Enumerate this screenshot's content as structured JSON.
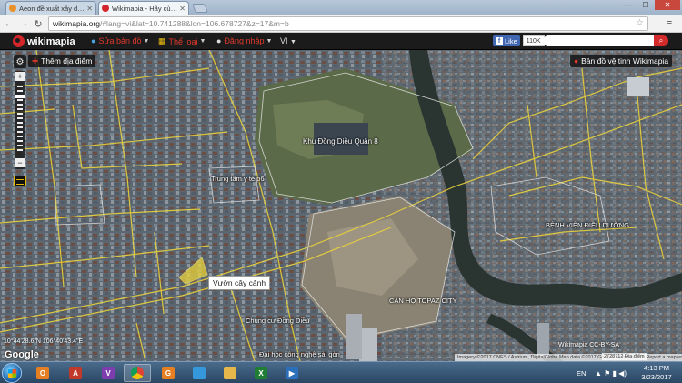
{
  "browser": {
    "tabs": [
      {
        "label": "Aeon đề xuất xây dựng tổ",
        "favicon_color": "#e8912a",
        "active": false
      },
      {
        "label": "Wikimapia - Hãy cùng nh",
        "favicon_color": "#d4262a",
        "active": true
      }
    ],
    "window_controls": {
      "minimize": "—",
      "maximize": "☐",
      "close": "✕"
    },
    "url_host": "wikimapia.org",
    "url_rest": "/#lang=vi&lat=10.741288&lon=106.678727&z=17&m=b"
  },
  "wikimapia": {
    "logo": "wikimapia",
    "menu": [
      {
        "label": "Sửa bản đồ",
        "icon": "globe-icon"
      },
      {
        "label": "Thể loại",
        "icon": "category-icon"
      },
      {
        "label": "Đăng nhập",
        "icon": "user-icon"
      }
    ],
    "language": "VI",
    "facebook": {
      "like": "Like",
      "count": "110K"
    },
    "search_button_icon": "search-icon"
  },
  "map": {
    "add_place": "Thêm địa điểm",
    "satellite_toggle": "Bản đồ vệ tinh Wikimapia",
    "zoom_in": "+",
    "zoom_out": "−",
    "labels": [
      {
        "text": "Khu Đồng Diều Quận 8"
      },
      {
        "text": "Trung tâm y tế p6"
      },
      {
        "text": "BỆNH VIỆN ĐIỀU DƯỠNG"
      },
      {
        "text": "CĂN HỘ TOPAZ CITY"
      },
      {
        "text": "Chung cư Đồng Diều"
      },
      {
        "text": "Đại học công nghệ sài gòn"
      }
    ],
    "tooltip": "Vườn cây cảnh",
    "coords": "10°44'28.6\"N 106°40'43.4\"E",
    "google": "Google",
    "attribution": "Imagery ©2017 CNES / Astrium, DigitalGlobe   Map data ©2017 Google   Terms of Use   Report a map error",
    "wm_cc": "Wikimapia CC-BY-SA",
    "scale_text": "2728712 Địa điểm"
  },
  "taskbar": {
    "apps": [
      {
        "name": "outlook",
        "letter": "O",
        "color": "#e67e22"
      },
      {
        "name": "acrobat",
        "letter": "A",
        "color": "#c0392b"
      },
      {
        "name": "viber",
        "letter": "V",
        "color": "#7d3daf"
      },
      {
        "name": "chrome",
        "letter": "",
        "color": "#f4c20d"
      },
      {
        "name": "foxit",
        "letter": "G",
        "color": "#e67e22"
      },
      {
        "name": "picture",
        "letter": "",
        "color": "#3498db"
      },
      {
        "name": "explorer",
        "letter": "",
        "color": "#e6b84c"
      },
      {
        "name": "excel",
        "letter": "X",
        "color": "#1e7e34"
      },
      {
        "name": "media",
        "letter": "▶",
        "color": "#2c6fbb"
      }
    ],
    "language": "EN",
    "time": "4:13 PM",
    "date": "3/23/2017"
  }
}
